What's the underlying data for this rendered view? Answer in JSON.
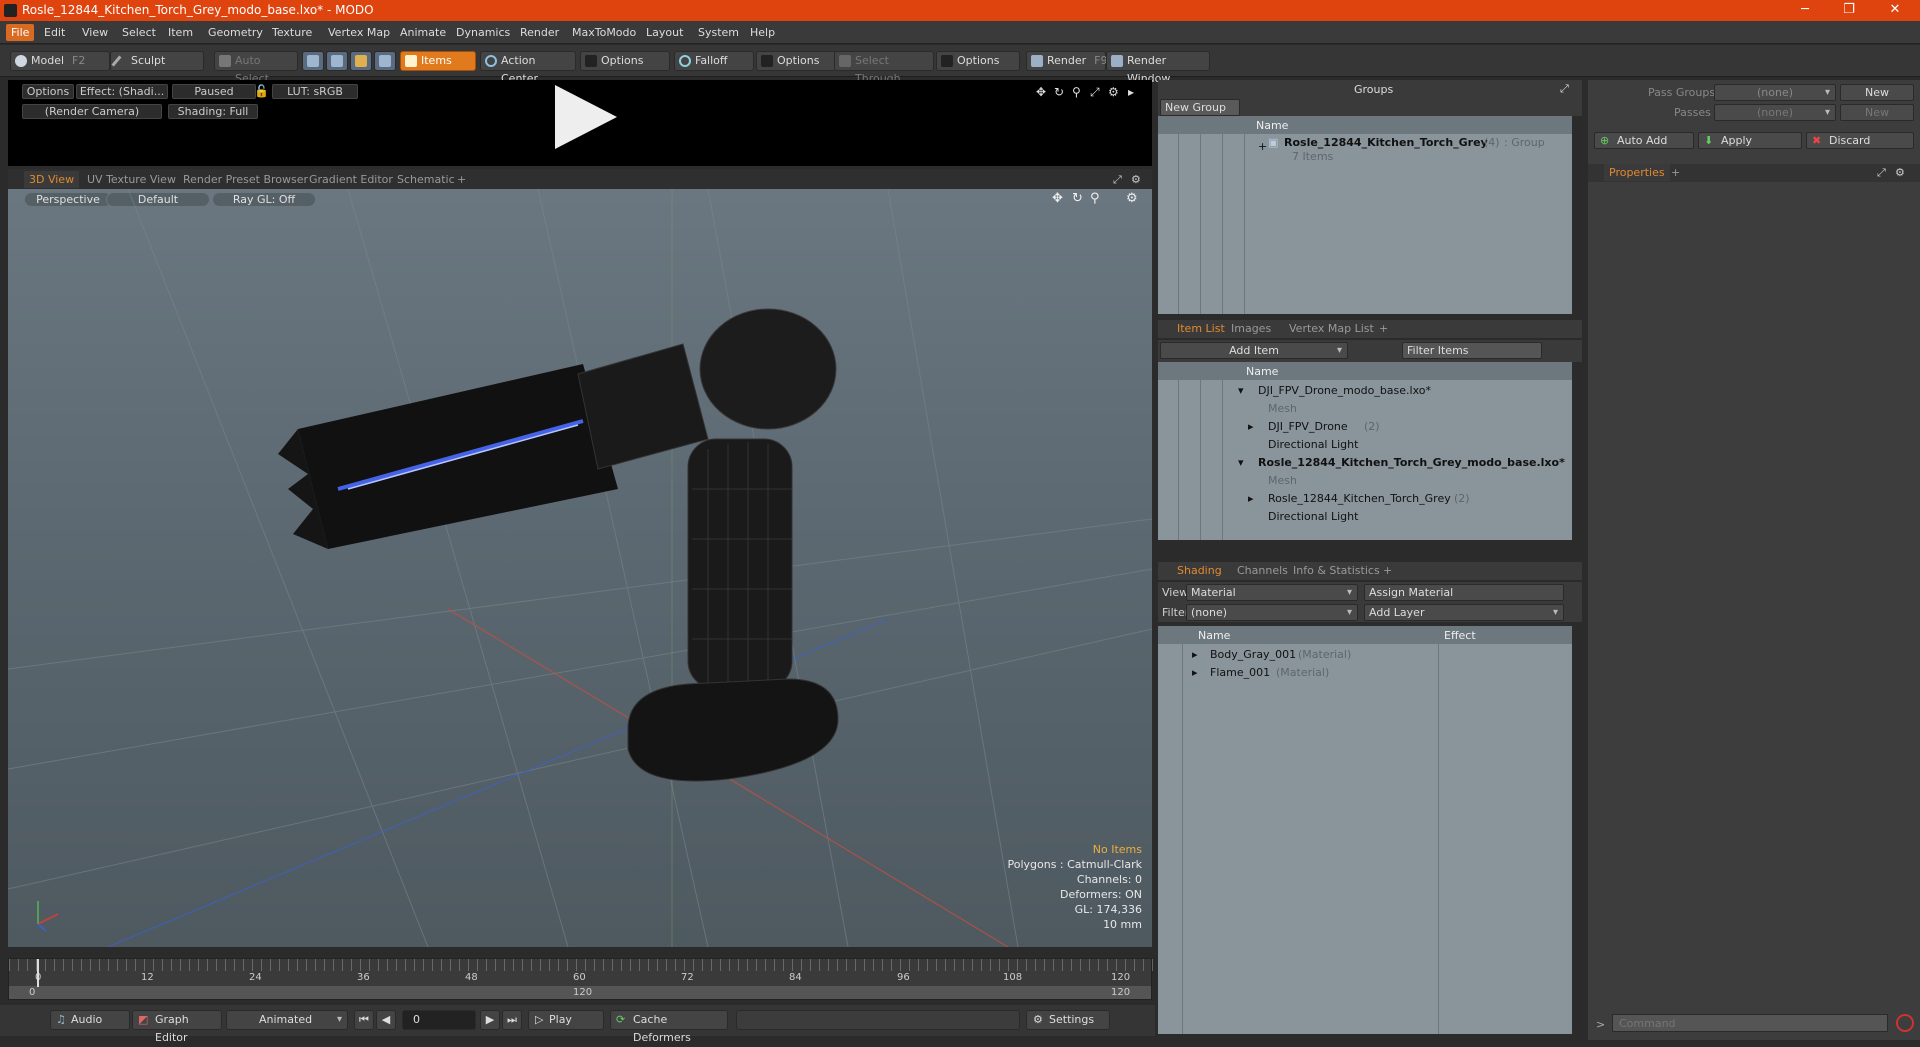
{
  "window": {
    "title": "Rosle_12844_Kitchen_Torch_Grey_modo_base.lxo* - MODO",
    "minimize": "─",
    "maximize": "❐",
    "close": "✕"
  },
  "menu": [
    "File",
    "Edit",
    "View",
    "Select",
    "Item",
    "Geometry",
    "Texture",
    "Vertex Map",
    "Animate",
    "Dynamics",
    "Render",
    "MaxToModo",
    "Layout",
    "System",
    "Help"
  ],
  "toolbar": {
    "model": "Model",
    "model_key": "F2",
    "sculpt": "Sculpt",
    "auto_select": "Auto Select",
    "items": "Items",
    "action_center": "Action Center",
    "options1": "Options",
    "falloff": "Falloff",
    "options2": "Options",
    "select_through": "Select Through",
    "options3": "Options",
    "render": "Render",
    "render_key": "F9",
    "render_window": "Render Window"
  },
  "preview": {
    "options": "Options",
    "effect": "Effect: (Shadi...",
    "paused": "Paused",
    "lut": "LUT: sRGB",
    "camera": "(Render Camera)",
    "shading": "Shading: Full"
  },
  "viewport_tabs": [
    "3D View",
    "UV Texture View",
    "Render Preset Browser",
    "Gradient Editor",
    "Schematic",
    "+"
  ],
  "viewport": {
    "perspective": "Perspective",
    "default": "Default",
    "raygl": "Ray GL: Off",
    "stats": {
      "no_items": "No Items",
      "polygons": "Polygons : Catmull-Clark",
      "channels": "Channels: 0",
      "deformers": "Deformers: ON",
      "gl": "GL: 174,336",
      "unit": "10 mm"
    }
  },
  "timeline": {
    "ticks": [
      "0",
      "12",
      "24",
      "36",
      "48",
      "60",
      "72",
      "84",
      "96",
      "108",
      "120"
    ],
    "start": "0",
    "end": "120",
    "mid": "120"
  },
  "bottombar": {
    "audio": "Audio",
    "graph_editor": "Graph Editor",
    "animated": "Animated",
    "frame": "0",
    "play": "Play",
    "cache_deformers": "Cache Deformers",
    "settings": "Settings"
  },
  "groups": {
    "title": "Groups",
    "new_group": "New Group",
    "name_col": "Name",
    "group_name": "Rosle_12844_Kitchen_Torch_Grey",
    "group_count": "(4)",
    "group_type": ": Group",
    "items_count": "7 Items"
  },
  "item_list": {
    "tabs": [
      "Item List",
      "Images",
      "Vertex Map List",
      "+"
    ],
    "add_item": "Add Item",
    "filter_items": "Filter Items",
    "name_col": "Name",
    "rows": [
      {
        "label": "DJI_FPV_Drone_modo_base.lxo*",
        "extra": "",
        "bold": false
      },
      {
        "label": "Mesh",
        "extra": "",
        "bold": false
      },
      {
        "label": "DJI_FPV_Drone",
        "extra": "(2)",
        "bold": false
      },
      {
        "label": "Directional Light",
        "extra": "",
        "bold": false
      },
      {
        "label": "Rosle_12844_Kitchen_Torch_Grey_modo_base.lxo*",
        "extra": "",
        "bold": true
      },
      {
        "label": "Mesh",
        "extra": "",
        "bold": false
      },
      {
        "label": "Rosle_12844_Kitchen_Torch_Grey",
        "extra": "(2)",
        "bold": false
      },
      {
        "label": "Directional Light",
        "extra": "",
        "bold": false
      }
    ]
  },
  "shading": {
    "tabs": [
      "Shading",
      "Channels",
      "Info & Statistics",
      "+"
    ],
    "view_label": "View",
    "view_value": "Material",
    "assign_material": "Assign Material",
    "filter_label": "Filter",
    "filter_value": "(none)",
    "add_layer": "Add Layer",
    "name_col": "Name",
    "effect_col": "Effect",
    "rows": [
      {
        "label": "Body_Gray_001",
        "type": "(Material)"
      },
      {
        "label": "Flame_001",
        "type": "(Material)"
      }
    ]
  },
  "passes": {
    "pass_groups": "Pass Groups",
    "passes": "Passes",
    "none1": "(none)",
    "none2": "(none)",
    "new1": "New",
    "new2": "New",
    "auto_add": "Auto Add",
    "apply": "Apply",
    "discard": "Discard",
    "properties_tab": "Properties",
    "plus": "+"
  },
  "command": {
    "placeholder": "Command",
    "prompt": ">"
  },
  "colors": {
    "accent": "#e07a1c",
    "titlebar": "#e0440e"
  }
}
